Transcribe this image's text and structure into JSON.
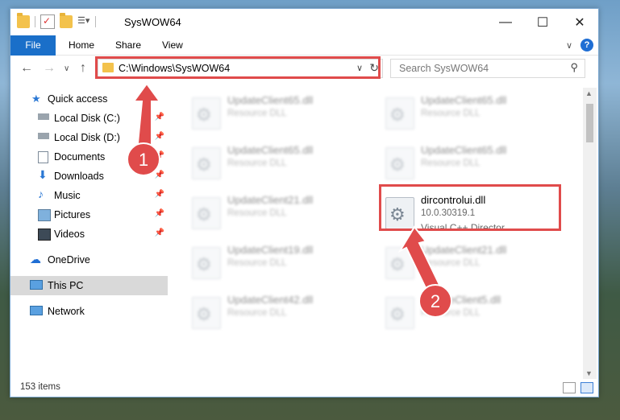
{
  "window": {
    "title": "SysWOW64"
  },
  "window_buttons": {
    "minimize": "—",
    "maximize": "☐",
    "close": "✕"
  },
  "ribbon": {
    "tabs": [
      "File",
      "Home",
      "Share",
      "View"
    ]
  },
  "address": {
    "path": "C:\\Windows\\SysWOW64"
  },
  "search": {
    "placeholder": "Search SysWOW64"
  },
  "sidebar": {
    "items": [
      {
        "label": "Quick access",
        "pinned": false
      },
      {
        "label": "Local Disk (C:)",
        "pinned": true
      },
      {
        "label": "Local Disk (D:)",
        "pinned": true
      },
      {
        "label": "Documents",
        "pinned": true
      },
      {
        "label": "Downloads",
        "pinned": true
      },
      {
        "label": "Music",
        "pinned": true
      },
      {
        "label": "Pictures",
        "pinned": true
      },
      {
        "label": "Videos",
        "pinned": true
      },
      {
        "label": "OneDrive",
        "pinned": false
      },
      {
        "label": "This PC",
        "pinned": false,
        "selected": true
      },
      {
        "label": "Network",
        "pinned": false
      }
    ]
  },
  "files": [
    {
      "name": "UpdateClient65.dll",
      "line2": "Resource DLL",
      "line3": ""
    },
    {
      "name": "UpdateClient65.dll",
      "line2": "Resource DLL",
      "line3": ""
    },
    {
      "name": "UpdateClient65.dll",
      "line2": "Resource DLL",
      "line3": ""
    },
    {
      "name": "UpdateClient65.dll",
      "line2": "Resource DLL",
      "line3": ""
    },
    {
      "name": "UpdateClient21.dll",
      "line2": "Resource DLL",
      "line3": ""
    },
    {
      "name": "dircontrolui.dll",
      "line2": "10.0.30319.1",
      "line3": "Visual C++ Director..."
    },
    {
      "name": "UpdateClient19.dll",
      "line2": "Resource DLL",
      "line3": ""
    },
    {
      "name": "UpdateClient21.dll",
      "line2": "Resource DLL",
      "line3": ""
    },
    {
      "name": "UpdateClient42.dll",
      "line2": "Resource DLL",
      "line3": ""
    },
    {
      "name": "UpdateClient5.dll",
      "line2": "Resource DLL",
      "line3": ""
    }
  ],
  "status": {
    "item_count": "153 items"
  },
  "annotations": {
    "badge1": "1",
    "badge2": "2",
    "color": "#e04b4b"
  }
}
